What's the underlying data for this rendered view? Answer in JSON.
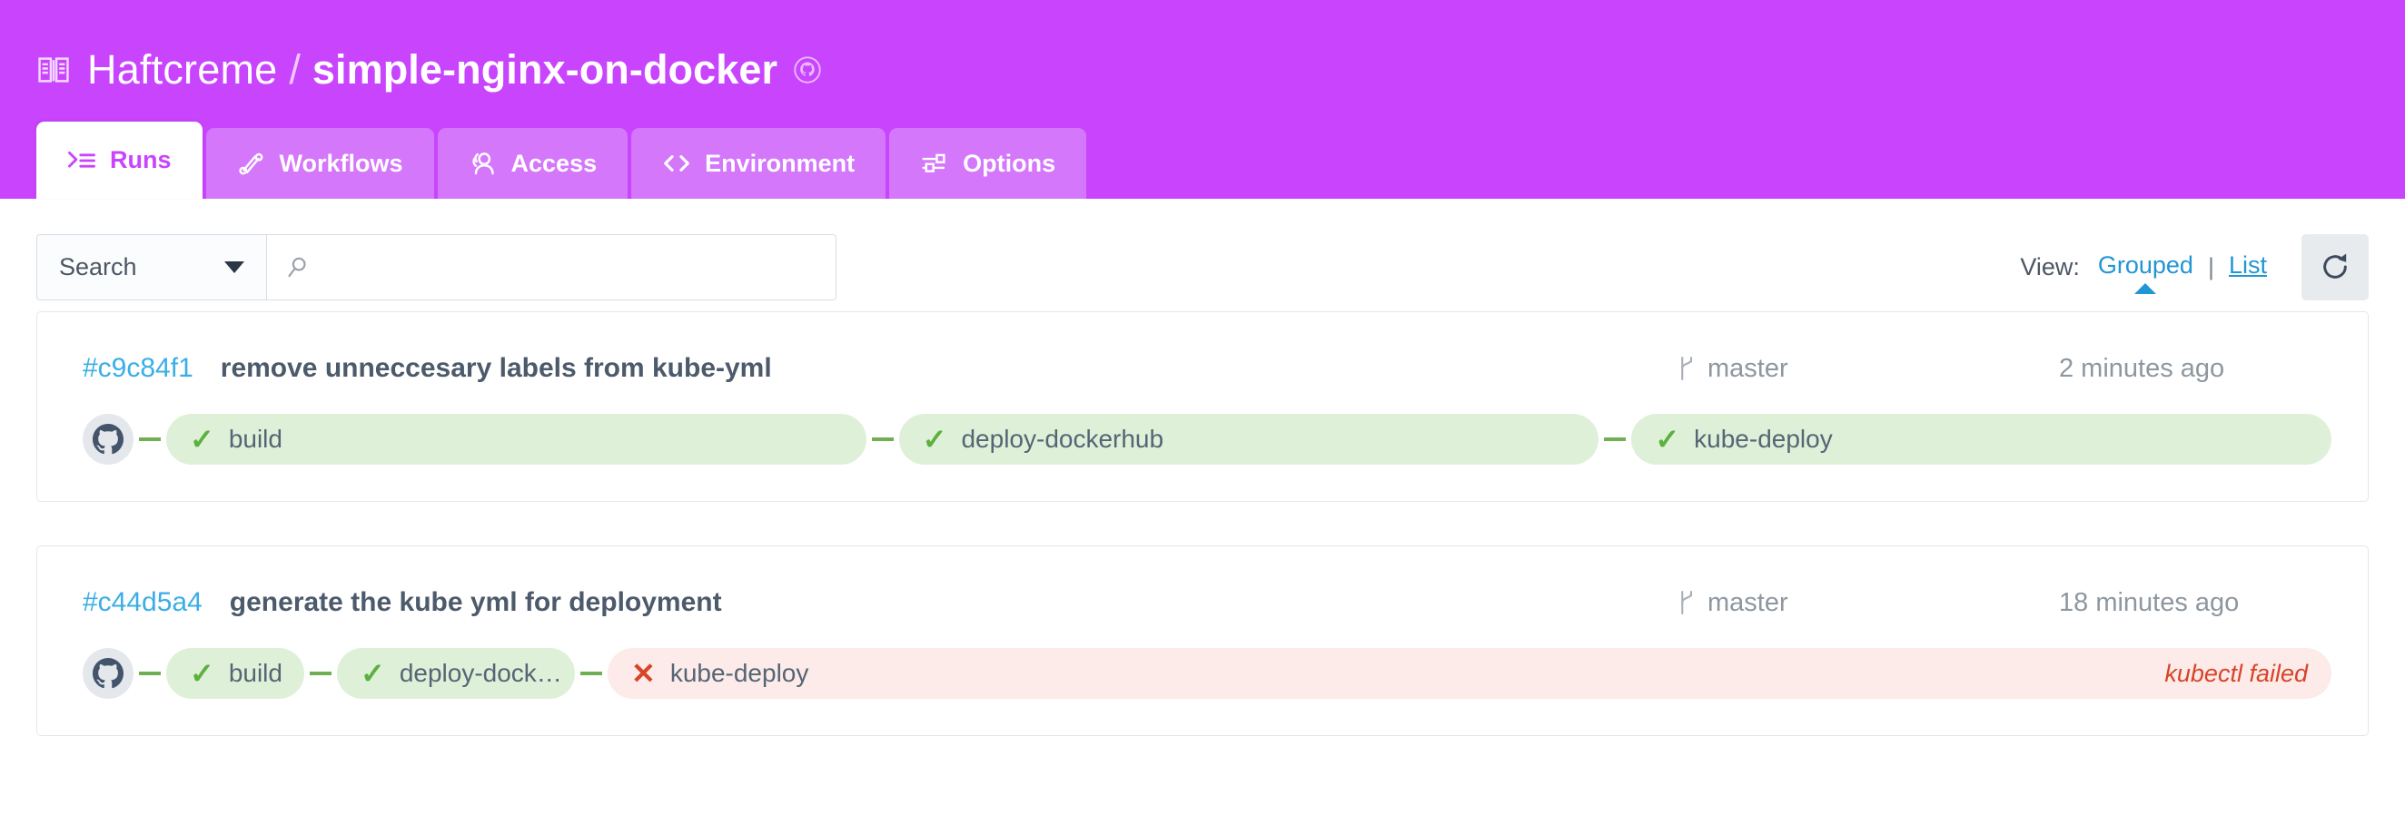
{
  "header": {
    "owner": "Haftcreme",
    "separator": "/",
    "repo": "simple-nginx-on-docker",
    "book_icon": "book-icon",
    "repo_source_icon": "github-icon",
    "background_color": "#c944fd",
    "tabs": [
      {
        "label": "Runs",
        "icon": "runs-icon",
        "active": true
      },
      {
        "label": "Workflows",
        "icon": "workflows-icon",
        "active": false
      },
      {
        "label": "Access",
        "icon": "access-icon",
        "active": false
      },
      {
        "label": "Environment",
        "icon": "code-brackets-icon",
        "active": false
      },
      {
        "label": "Options",
        "icon": "sliders-icon",
        "active": false
      }
    ]
  },
  "toolbar": {
    "search_select_value": "Search",
    "search_input_value": "",
    "search_input_placeholder": "",
    "search_icon": "magnifier-icon",
    "view_label": "View:",
    "view_grouped": "Grouped",
    "view_separator": "|",
    "view_list": "List",
    "active_view": "Grouped",
    "refresh_icon": "refresh-icon",
    "link_color": "#2196d4"
  },
  "runs": [
    {
      "sha": "#c9c84f1",
      "message": "remove unneccesary labels from kube-yml",
      "branch": "master",
      "branch_icon": "branch-icon",
      "time": "2 minutes ago",
      "source_icon": "github-icon",
      "stages": [
        {
          "name": "build",
          "status": "success",
          "icon": "✓",
          "flex": 1.0,
          "error": ""
        },
        {
          "name": "deploy-dockerhub",
          "status": "success",
          "icon": "✓",
          "flex": 1.0,
          "error": ""
        },
        {
          "name": "kube-deploy",
          "status": "success",
          "icon": "✓",
          "flex": 1.0,
          "error": ""
        }
      ]
    },
    {
      "sha": "#c44d5a4",
      "message": "generate the kube yml for deployment",
      "branch": "master",
      "branch_icon": "branch-icon",
      "time": "18 minutes ago",
      "source_icon": "github-icon",
      "stages": [
        {
          "name": "build",
          "status": "success",
          "icon": "✓",
          "flex": 0.0,
          "error": ""
        },
        {
          "name": "deploy-dock…",
          "status": "success",
          "icon": "✓",
          "flex": 0.0,
          "error": ""
        },
        {
          "name": "kube-deploy",
          "status": "failed",
          "icon": "✕",
          "flex": 1.0,
          "error": "kubectl failed"
        }
      ]
    }
  ],
  "colors": {
    "success_bg": "#dff0d8",
    "success_fg": "#5cb040",
    "failed_bg": "#fcebe8",
    "failed_fg": "#d9432a",
    "accent_purple": "#c944fd",
    "link_blue": "#3aaee6"
  }
}
